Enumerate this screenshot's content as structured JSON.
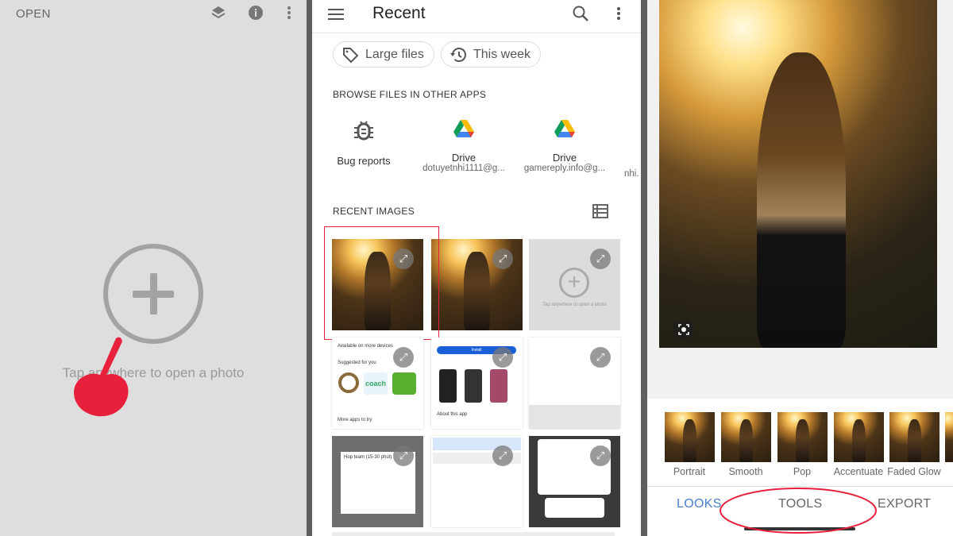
{
  "left_screen": {
    "open_label": "OPEN",
    "icons": [
      "layers-icon",
      "info-icon",
      "more-vert-icon"
    ],
    "add_icon": "plus-circle-icon",
    "tap_text": "Tap anywhere to open a photo",
    "annotation_icon": "hand-pointer-icon",
    "annotation_color": "#e8203c"
  },
  "middle_screen": {
    "title": "Recent",
    "chips": [
      {
        "label": "Large files",
        "icon": "tag-icon"
      },
      {
        "label": "This week",
        "icon": "history-icon"
      }
    ],
    "browse_header": "BROWSE FILES IN OTHER APPS",
    "apps": [
      {
        "name": "Bug reports",
        "sub": "",
        "icon": "bug-icon"
      },
      {
        "name": "Drive",
        "sub": "dotuyetnhi1111@g...",
        "icon": "google-drive-icon"
      },
      {
        "name": "Drive",
        "sub": "gamereply.info@g...",
        "icon": "google-drive-icon"
      },
      {
        "name": "",
        "sub": "nhi.",
        "icon": ""
      }
    ],
    "recent_images_header": "RECENT IMAGES",
    "thumb_texts": {
      "tap_open": "Tap anywhere to open a photo",
      "available": "Available on more devices",
      "suggested": "Suggested for you",
      "more_apps": "More apps to try",
      "install": "Install",
      "about": "About this app",
      "meeting": "Hop team (15-30 phút)"
    },
    "highlight_color": "#e8203c"
  },
  "right_screen": {
    "scan_icon": "lens-icon",
    "filters": [
      "Portrait",
      "Smooth",
      "Pop",
      "Accentuate",
      "Faded Glow"
    ],
    "tabs": {
      "looks": "LOOKS",
      "tools": "TOOLS",
      "export": "EXPORT"
    },
    "active_tab": "LOOKS",
    "accent_color": "#4a7fd0",
    "annotation_color": "#e8203c"
  }
}
